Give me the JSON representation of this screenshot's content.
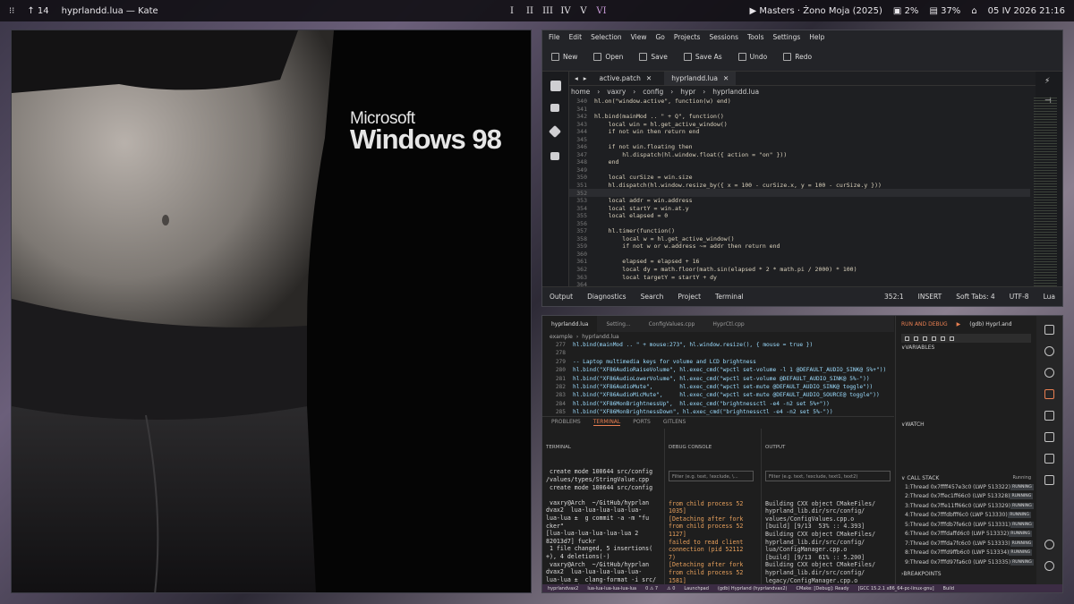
{
  "topbar": {
    "app_title": "hyprlandd.lua — Kate",
    "updates": "14",
    "workspaces": [
      "I",
      "II",
      "III",
      "IV",
      "V",
      "VI"
    ],
    "active_workspace": 5,
    "now_playing": "Masters · Żono Moja (2025)",
    "cpu": "2%",
    "ram": "37%",
    "clock": "05 IV 2026 21:16"
  },
  "wallpaper": {
    "brand_top": "Microsoft",
    "brand_bottom": "Windows 98"
  },
  "kate": {
    "menu": [
      "File",
      "Edit",
      "Selection",
      "View",
      "Go",
      "Projects",
      "Sessions",
      "Tools",
      "Settings",
      "Help"
    ],
    "toolbar": [
      "New",
      "Open",
      "Save",
      "Save As",
      "Undo",
      "Redo"
    ],
    "tabs": [
      {
        "label": "active.patch"
      },
      {
        "label": "hyprlandd.lua"
      }
    ],
    "breadcrumb": [
      "home",
      "vaxry",
      "config",
      "hypr",
      "hyprlandd.lua"
    ],
    "line_numbers": [
      "340",
      "341",
      "342",
      "343",
      "344",
      "345",
      "346",
      "347",
      "348",
      "349",
      "350",
      "351",
      "352",
      "353",
      "354",
      "355",
      "356",
      "357",
      "358",
      "359",
      "360",
      "361",
      "362",
      "363",
      "364"
    ],
    "lines": [
      "hl.on(\"window.active\", function(w) end)",
      "",
      "hl.bind(mainMod .. \" + Q\", function()",
      "    local win = hl.get_active_window()",
      "    if not win then return end",
      "",
      "    if not win.floating then",
      "        hl.dispatch(hl.window.float({ action = \"on\" }))",
      "    end",
      "",
      "    local curSize = win.size",
      "    hl.dispatch(hl.window.resize_by({ x = 100 - curSize.x, y = 100 - curSize.y }))",
      "",
      "    local addr = win.address",
      "    local startY = win.at.y",
      "    local elapsed = 0",
      "",
      "    hl.timer(function()",
      "        local w = hl.get_active_window()",
      "        if not w or w.address ~= addr then return end",
      "",
      "        elapsed = elapsed + 16",
      "        local dy = math.floor(math.sin(elapsed * 2 * math.pi / 2000) * 100)",
      "        local targetY = startY + dy",
      ""
    ],
    "status_left": [
      "Output",
      "Diagnostics",
      "Search",
      "Project",
      "Terminal"
    ],
    "status_right": [
      "352:1",
      "INSERT",
      "Soft Tabs: 4",
      "UTF-8",
      "Lua"
    ]
  },
  "vscode": {
    "tabs": [
      "hyprlandd.lua",
      "Setting...",
      "ConfigValues.cpp",
      "HyprCtl.cpp"
    ],
    "breadcrumb": [
      "example",
      "hyprlandd.lua"
    ],
    "editor_lines": [
      {
        "n": "277",
        "t": "hl.bind(mainMod .. \" + mouse:273\", hl.window.resize(), { mouse = true })"
      },
      {
        "n": "278",
        "t": ""
      },
      {
        "n": "279",
        "t": "-- Laptop multimedia keys for volume and LCD brightness"
      },
      {
        "n": "280",
        "t": "hl.bind(\"XF86AudioRaiseVolume\", hl.exec_cmd(\"wpctl set-volume -l 1 @DEFAULT_AUDIO_SINK@ 5%+\"))"
      },
      {
        "n": "281",
        "t": "hl.bind(\"XF86AudioLowerVolume\", hl.exec_cmd(\"wpctl set-volume @DEFAULT_AUDIO_SINK@ 5%-\"))"
      },
      {
        "n": "282",
        "t": "hl.bind(\"XF86AudioMute\",        hl.exec_cmd(\"wpctl set-mute @DEFAULT_AUDIO_SINK@ toggle\"))"
      },
      {
        "n": "283",
        "t": "hl.bind(\"XF86AudioMicMute\",     hl.exec_cmd(\"wpctl set-mute @DEFAULT_AUDIO_SOURCE@ toggle\"))"
      },
      {
        "n": "284",
        "t": "hl.bind(\"XF86MonBrightnessUp\",  hl.exec_cmd(\"brightnessctl -e4 -n2 set 5%+\"))"
      },
      {
        "n": "285",
        "t": "hl.bind(\"XF86MonBrightnessDown\", hl.exec_cmd(\"brightnessctl -e4 -n2 set 5%-\"))"
      }
    ],
    "panel_tabs": [
      "PROBLEMS",
      "TERMINAL",
      "PORTS",
      "GITLENS"
    ],
    "terminal_title": "TERMINAL",
    "terminal_lines": [
      " create mode 100644 src/config",
      "/values/types/StringValue.cpp",
      " create mode 100644 src/config",
      "",
      " vaxry@Arch  ~/GitHub/hyprlan",
      "dvax2  lua-lua-lua-lua-lua-",
      "lua-lua ±  g commit -a -m \"fu",
      "cker\"",
      "[lua-lua-lua-lua-lua-lua 2",
      "82013d7] fuckr",
      " 1 file changed, 5 insertions(",
      "+), 4 deletions(-)",
      " vaxry@Arch  ~/GitHub/hyprlan",
      "dvax2  lua-lua-lua-lua-lua-",
      "lua-lua ±  clang-format -i src/",
      "**/*{cpp,hpp}",
      " vaxry@Arch  ~/GitHub/hyprlan",
      "dvax2  lua-lua-lua-lua-lua-",
      "lua-lua ±"
    ],
    "debug_title": "DEBUG CONSOLE",
    "debug_filter": "Filter (e.g. text, !exclude, \\...",
    "debug_lines": [
      "from child process 52",
      "1035]",
      "[Detaching after fork",
      "from child process 52",
      "1127]",
      "failed to read client",
      "connection (pid 52112",
      "7)",
      "[Detaching after fork",
      "from child process 52",
      "1581]",
      "[Detaching after fork",
      "from child process 52",
      "1793]"
    ],
    "output_title": "OUTPUT",
    "output_filter": "Filter (e.g. text, !exclude, text1, text2)",
    "output_lines": [
      "Building CXX object CMakeFiles/",
      "hyprland_lib.dir/src/config/",
      "values/ConfigValues.cpp.o",
      "[build] [9/13  53% :: 4.393]",
      "Building CXX object CMakeFiles/",
      "hyprland_lib.dir/src/config/",
      "lua/ConfigManager.cpp.o",
      "[build] [9/13  61% :: 5.200]",
      "Building CXX object CMakeFiles/",
      "hyprland_lib.dir/src/config/",
      "legacy/ConfigManager.cpp.o",
      "[build] [9/13  69% :: 5.544]",
      "Building CXX object CMakeFiles/",
      "hyprland_lib.dir/src/debug/",
      "HyprCtl.cpp.o"
    ],
    "run_debug": "RUN AND DEBUG",
    "debug_config": "(gdb) Hyprl.and",
    "variables": "VARIABLES",
    "watch": "WATCH",
    "call_stack": "CALL STACK",
    "call_stack_status": "Running",
    "threads": [
      "1:Thread 0x7ffff457e3c0 (LWP 513322)",
      "2:Thread 0x7ffec1ff66c0 (LWP 513328)",
      "3:Thread 0x7ffe11ff66c0 (LWP 513329)",
      "4:Thread 0x7fffdbfff6c0 (LWP 513330)",
      "5:Thread 0x7fffdb7fe6c0 (LWP 513331)",
      "6:Thread 0x7fffdaffd6c0 (LWP 513332)",
      "7:Thread 0x7fffda7fc6c0 (LWP 513333)",
      "8:Thread 0x7fffd9ffb6c0 (LWP 513334)",
      "9:Thread 0x7fffd97fa6c0 (LWP 513335)"
    ],
    "thread_state": "RUNNING",
    "breakpoints": "BREAKPOINTS",
    "statusbar": [
      "hyprlandvax2",
      "lua-lua-lua-lua-lua-lua",
      "0 ⚠ 7",
      "⚠ 0",
      "Launchpad",
      "(gdb) Hyprland (hyprlandvax2)",
      "CMake: [Debug]: Ready",
      "[GCC 15.2.1 x86_64-pc-linux-gnu]",
      "Build"
    ]
  }
}
